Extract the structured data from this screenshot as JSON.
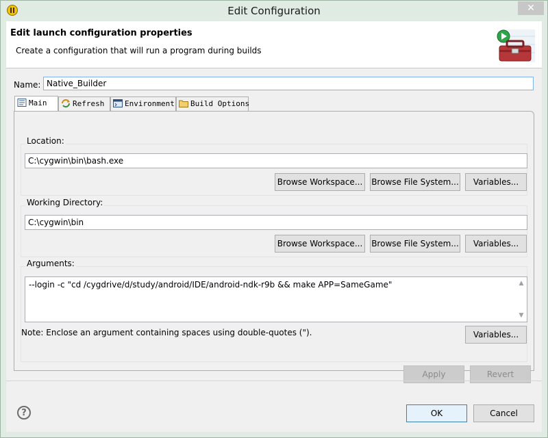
{
  "window": {
    "title": "Edit Configuration",
    "close_glyph": "✕"
  },
  "header": {
    "title": "Edit launch configuration properties",
    "description": "Create a configuration that will run a program during builds",
    "icon": "toolbox-run-icon"
  },
  "name": {
    "label": "Name:",
    "value": "Native_Builder"
  },
  "tabs": [
    {
      "label": "Main",
      "icon": "main-tab-icon",
      "selected": true
    },
    {
      "label": "Refresh",
      "icon": "refresh-icon",
      "selected": false
    },
    {
      "label": "Environment",
      "icon": "environment-icon",
      "selected": false
    },
    {
      "label": "Build Options",
      "icon": "build-options-icon",
      "selected": false
    }
  ],
  "location": {
    "label": "Location:",
    "value": "C:\\cygwin\\bin\\bash.exe",
    "browse_workspace": "Browse Workspace...",
    "browse_file_system": "Browse File System...",
    "variables": "Variables..."
  },
  "working_directory": {
    "label": "Working Directory:",
    "value": "C:\\cygwin\\bin",
    "browse_workspace": "Browse Workspace...",
    "browse_file_system": "Browse File System...",
    "variables": "Variables..."
  },
  "arguments": {
    "label": "Arguments:",
    "value": "--login -c \"cd /cygdrive/d/study/android/IDE/android-ndk-r9b && make APP=SameGame\"",
    "variables": "Variables...",
    "note": "Note: Enclose an argument containing spaces using double-quotes (\")."
  },
  "actions": {
    "apply": "Apply",
    "revert": "Revert",
    "ok": "OK",
    "cancel": "Cancel"
  },
  "colors": {
    "accent": "#3c7fb1",
    "window_bg": "#e0ebe4",
    "dialog_bg": "#f0f0f0"
  }
}
